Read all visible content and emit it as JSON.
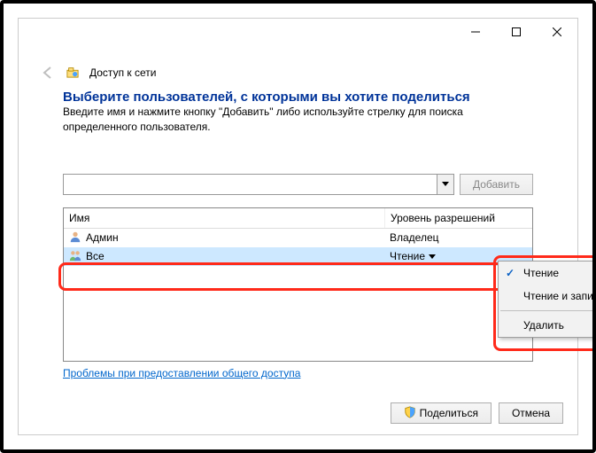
{
  "window_title": "Доступ к сети",
  "heading": "Выберите пользователей, с которыми вы хотите поделиться",
  "instruction": "Введите имя и нажмите кнопку \"Добавить\" либо используйте стрелку для поиска определенного пользователя.",
  "add_btn": "Добавить",
  "columns": {
    "name": "Имя",
    "perm": "Уровень разрешений"
  },
  "rows": [
    {
      "icon": "user",
      "name": "Админ",
      "perm": "Владелец"
    },
    {
      "icon": "group",
      "name": "Все",
      "perm": "Чтение"
    }
  ],
  "dropdown": {
    "read": "Чтение",
    "readwrite": "Чтение и запись",
    "remove": "Удалить"
  },
  "trouble_link": "Проблемы при предоставлении общего доступа",
  "share_btn": "Поделиться",
  "cancel_btn": "Отмена"
}
